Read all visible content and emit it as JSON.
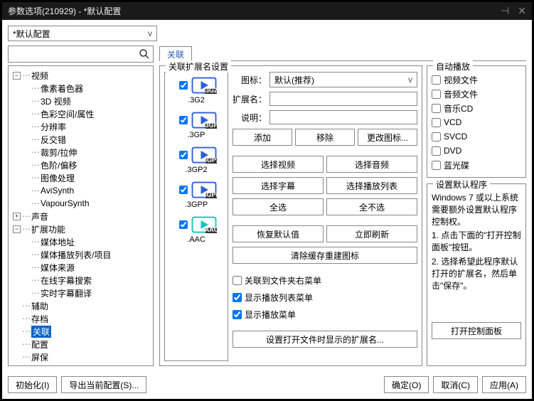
{
  "title": "参数选项(210929) - *默认配置",
  "configCombo": "*默认配置",
  "tab": "关联",
  "extLegend": "关联扩展名设置",
  "tree": {
    "video": {
      "label": "视频",
      "expand": "-",
      "children": [
        "像素着色器",
        "3D 视频",
        "色彩空间/属性",
        "分辨率",
        "反交错",
        "裁剪/拉伸",
        "色阶/偏移",
        "图像处理",
        "AviSynth",
        "VapourSynth"
      ]
    },
    "sound": {
      "label": "声音",
      "expand": "+"
    },
    "ext": {
      "label": "扩展功能",
      "expand": "-",
      "children": [
        "媒体地址",
        "媒体播放列表/项目",
        "媒体来源",
        "在线字幕搜索",
        "实时字幕翻译"
      ]
    },
    "aux": "辅助",
    "archive": "存档",
    "assoc": "关联",
    "config": "配置",
    "screensaver": "屏保"
  },
  "extList": [
    {
      "name": ".3G2",
      "tag": "3G2",
      "c": "#2e5fd9",
      "chk": true
    },
    {
      "name": ".3GP",
      "tag": "3GP",
      "c": "#2e5fd9",
      "chk": true
    },
    {
      "name": ".3GP2",
      "tag": "3GP2",
      "c": "#2e5fd9",
      "chk": true
    },
    {
      "name": ".3GPP",
      "tag": "3GPP",
      "c": "#2e5fd9",
      "chk": true
    },
    {
      "name": ".AAC",
      "tag": "AAC",
      "c": "#18c4b8",
      "chk": true
    }
  ],
  "form": {
    "iconLabel": "图标：",
    "iconValue": "默认(推荐)",
    "extLabel": "扩展名：",
    "extValue": "",
    "descLabel": "说明：",
    "descValue": ""
  },
  "btns": {
    "add": "添加",
    "remove": "移除",
    "changeIcon": "更改图标...",
    "selVideo": "选择视频",
    "selAudio": "选择音频",
    "selSub": "选择字幕",
    "selPlaylist": "选择播放列表",
    "selAll": "全选",
    "selNone": "全不选",
    "restore": "恢复默认值",
    "refresh": "立即刷新",
    "clearCache": "清除缓存重建图标",
    "setOpenExt": "设置打开文件时显示的扩展名...",
    "openCP": "打开控制面板"
  },
  "checks": {
    "ctxFolder": "关联到文件夹右菜单",
    "showPlaylistMenu": "显示播放列表菜单",
    "showPlayMenu": "显示播放菜单"
  },
  "autoplay": {
    "legend": "自动播放",
    "items": [
      "视频文件",
      "音频文件",
      "音乐CD",
      "VCD",
      "SVCD",
      "DVD",
      "蓝光碟"
    ]
  },
  "prog": {
    "legend": "设置默认程序",
    "l1": "Windows 7 或以上系统需要额外设置默认程序控制权。",
    "l2": "1. 点击下面的\"打开控制面板\"按钮。",
    "l3": "2. 选择希望此程序默认打开的扩展名，然后单击\"保存\"。"
  },
  "footer": {
    "init": "初始化(I)",
    "export": "导出当前配置(S)...",
    "ok": "确定(O)",
    "cancel": "取消(C)",
    "apply": "应用(A)"
  }
}
